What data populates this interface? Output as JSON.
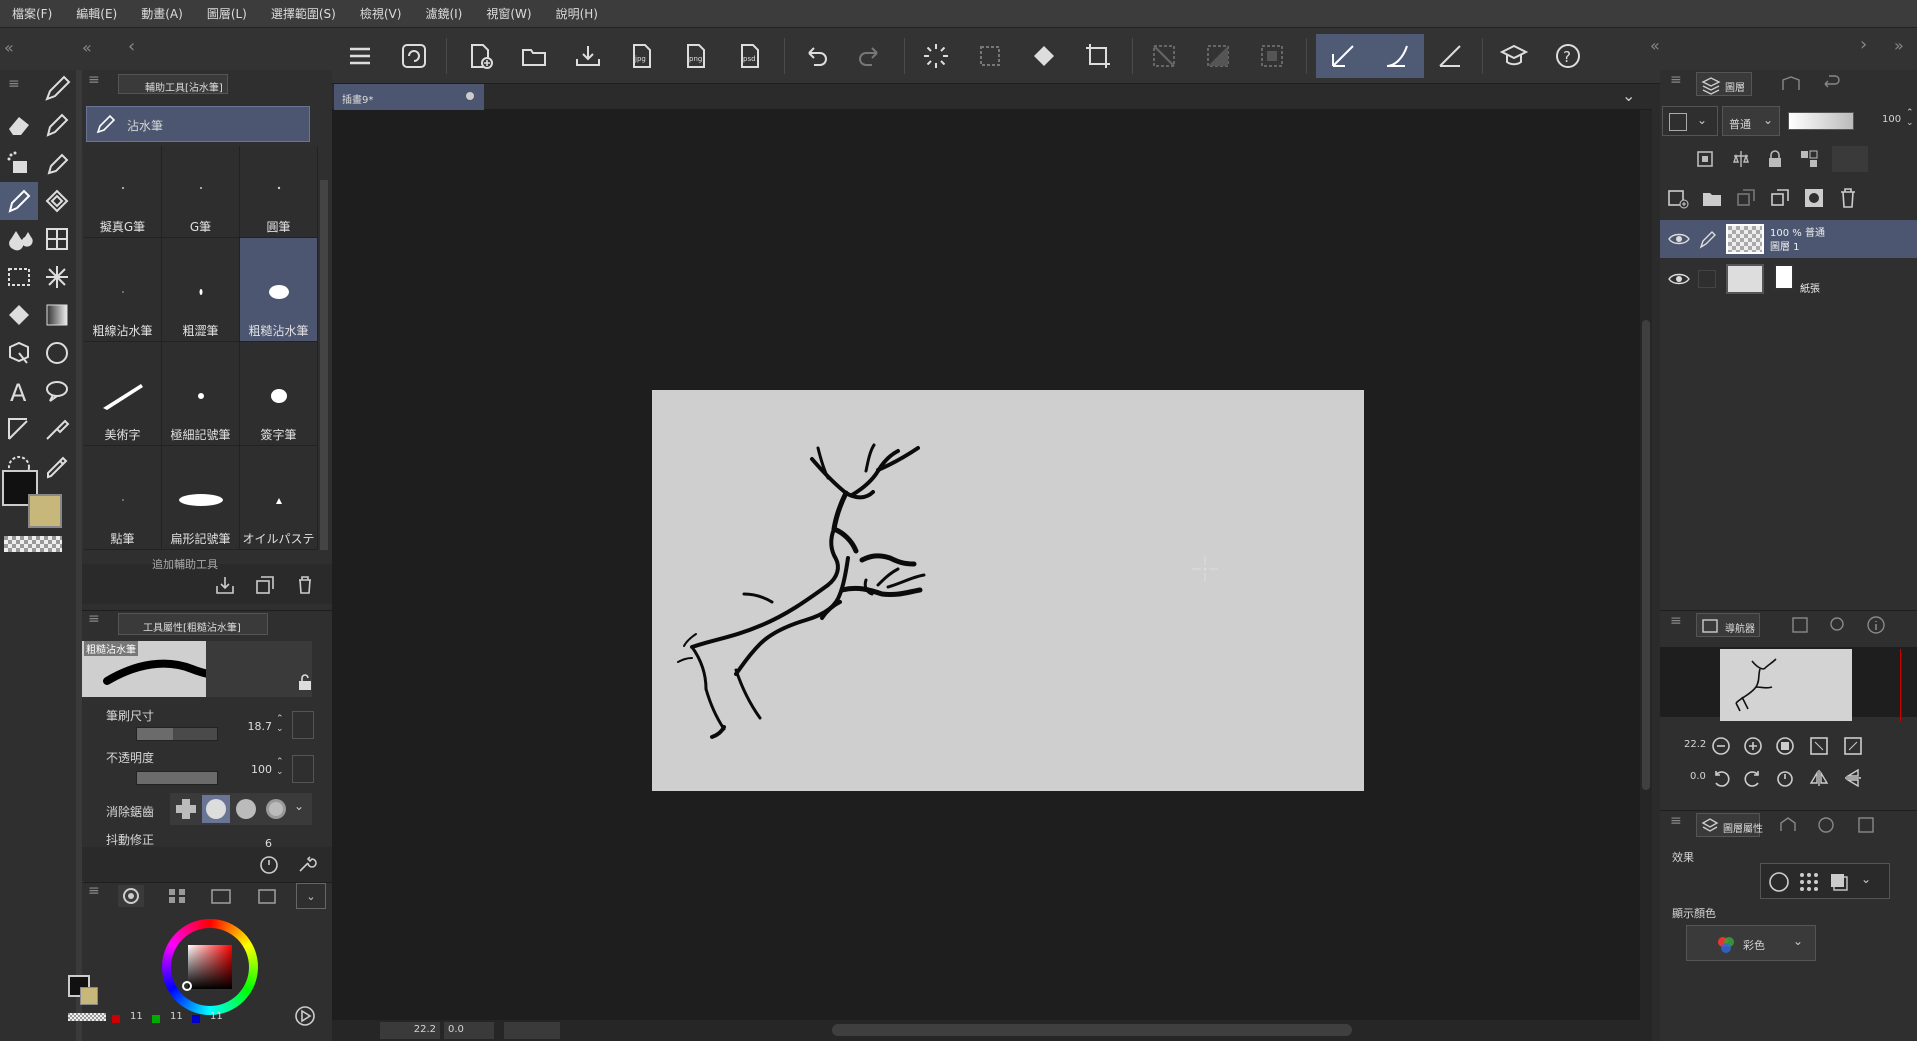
{
  "menu": [
    "檔案(F)",
    "編輯(E)",
    "動畫(A)",
    "圖層(L)",
    "選擇範圍(S)",
    "檢視(V)",
    "濾鏡(I)",
    "視窗(W)",
    "說明(H)"
  ],
  "canvas_tab": {
    "label": "插畫9*"
  },
  "subtool_panel": {
    "tab_label": "輔助工具[沾水筆]",
    "selected_group": "沾水筆",
    "brushes": [
      "擬真G筆",
      "G筆",
      "圓筆",
      "粗線沾水筆",
      "粗澀筆",
      "粗糙沾水筆",
      "美術字",
      "極細記號筆",
      "簽字筆",
      "點筆",
      "扁形記號筆",
      "オイルパステ"
    ],
    "selected_brush": "粗糙沾水筆",
    "add_subtool": "追加輔助工具"
  },
  "tool_property": {
    "tab_label": "工具屬性[粗糙沾水筆]",
    "preview_label": "粗糙沾水筆",
    "brush_size_label": "筆刷尺寸",
    "brush_size_value": "18.7",
    "brush_size_fraction": 0.45,
    "opacity_label": "不透明度",
    "opacity_value": "100",
    "opacity_fraction": 1.0,
    "antialias_label": "消除鋸齒",
    "stabilization_label": "抖動修正",
    "stabilization_value": "6"
  },
  "color_panel": {
    "main_color": "#111111",
    "sub_color": "#c8b77a",
    "rgb_values": [
      "11",
      "11",
      "11"
    ]
  },
  "layer_panel": {
    "tab_label": "圖層",
    "blend_mode": "普通",
    "opacity": "100",
    "layers": [
      {
        "title": "100 % 普通",
        "name": "圖層 1",
        "selected": true
      },
      {
        "title": "",
        "name": "紙張",
        "selected": false
      }
    ]
  },
  "navigator": {
    "tab_label": "導航器",
    "zoom": "22.2",
    "rotation": "0.0"
  },
  "layer_property": {
    "tab_label": "圖層屬性",
    "effect_label": "效果",
    "display_color_label": "顯示顏色",
    "display_color_value": "彩色"
  },
  "status_bar": {
    "zoom": "22.2",
    "rotation": "0.0"
  },
  "colors": {
    "accent": "#4f5a74",
    "canvas": "#cfcfcf",
    "workspace": "#1e1e1e"
  }
}
